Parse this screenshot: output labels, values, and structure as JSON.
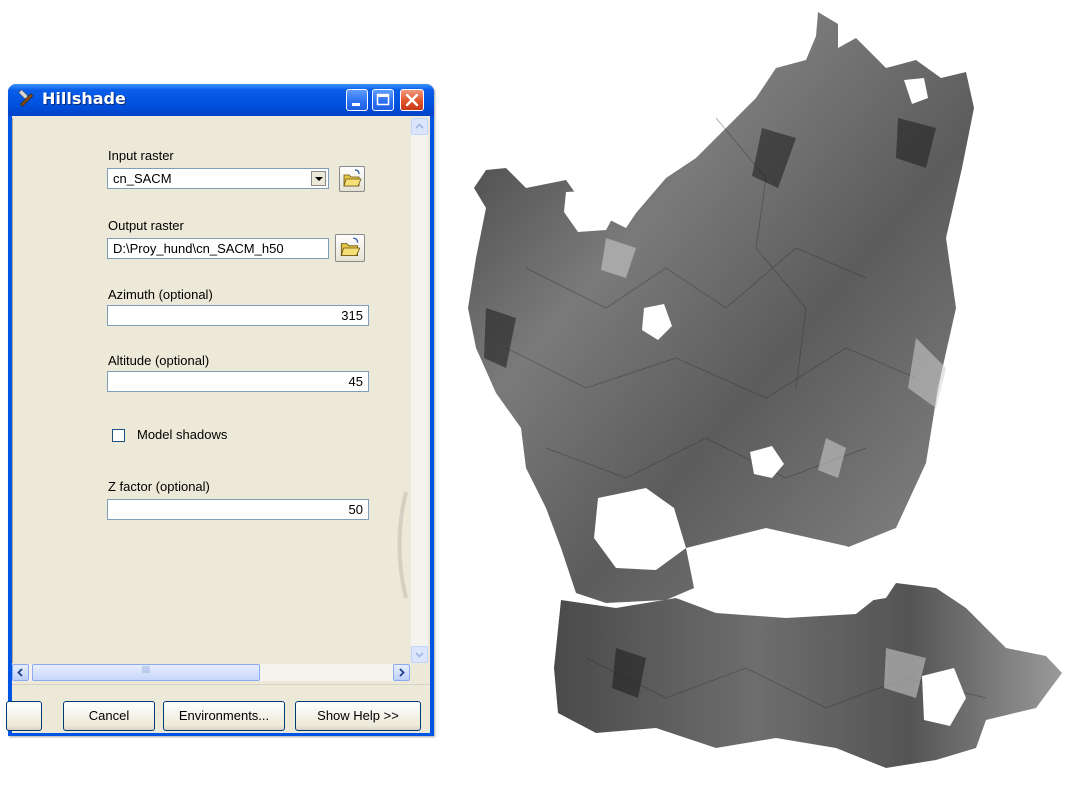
{
  "window": {
    "title": "Hillshade",
    "title_icon": "hammer-icon",
    "controls": [
      "minimize-icon",
      "maximize-icon",
      "close-icon"
    ]
  },
  "form": {
    "input_raster": {
      "label": "Input raster",
      "value": "cn_SACM"
    },
    "output_raster": {
      "label": "Output raster",
      "value": "D:\\Proy_hund\\cn_SACM_h50"
    },
    "azimuth": {
      "label": "Azimuth (optional)",
      "value": "315"
    },
    "altitude": {
      "label": "Altitude (optional)",
      "value": "45"
    },
    "model_shadows": {
      "label": "Model shadows",
      "checked": false
    },
    "z_factor": {
      "label": "Z factor (optional)",
      "value": "50"
    }
  },
  "buttons": {
    "cancel": "Cancel",
    "environments": "Environments...",
    "show_help": "Show Help >>"
  },
  "colors": {
    "titlebar": "#0054e3",
    "dialog_bg": "#ece9d8",
    "close_button": "#e2542c"
  }
}
